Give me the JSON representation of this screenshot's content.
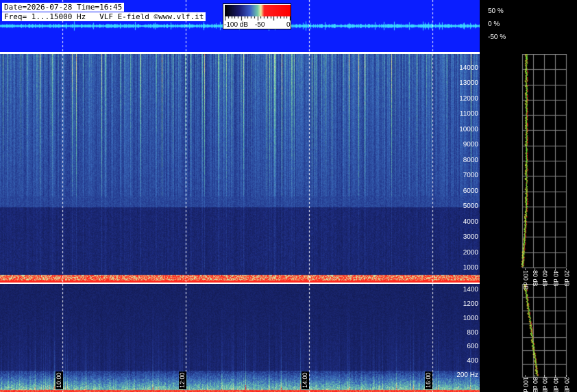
{
  "header": {
    "date_line": "Date=2026-07-28 Time=16:45",
    "freq_line": "Freq= 1...15000 Hz   VLF E-field ©www.vlf.it"
  },
  "colorbar": {
    "labels": [
      "-100 dB",
      "-50",
      "0"
    ],
    "colors": [
      "#000000",
      "#1a1a6e",
      "#3a5ac8",
      "#70c8a8",
      "#f0f0a0",
      "#ff2020",
      "#ff0000"
    ]
  },
  "amplitude_scale": [
    "50 %",
    "0 %",
    "-50 %"
  ],
  "top_panel_freq_labels": [
    "14000",
    "13000",
    "12000",
    "11000",
    "10000",
    "9000",
    "8000",
    "7000",
    "6000",
    "5000",
    "4000",
    "3000",
    "2000",
    "1000"
  ],
  "bottom_panel_freq_labels": [
    "1400",
    "1200",
    "1000",
    "800",
    "600",
    "400",
    "200 Hz"
  ],
  "time_labels": [
    "10:00",
    "12:00",
    "14:00",
    "16:00"
  ],
  "profile_db_labels": [
    "-100 dB",
    "-80 dB",
    "-60 dB",
    "-40 dB",
    "-20 dB"
  ],
  "colors": {
    "waveform_bg": "#0a1eff",
    "waveform_trace": "#3ad6ff",
    "spectrum_base": "#1a2a80",
    "profile_red": "#ff2020",
    "profile_yellow": "#ffff40",
    "profile_green": "#40ff40"
  }
}
